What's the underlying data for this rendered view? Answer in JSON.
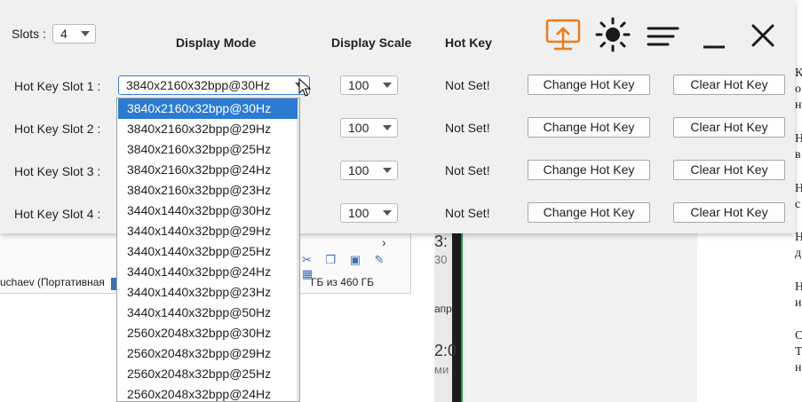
{
  "background": {
    "explorer": {
      "path_text": "uchaev (Портативная",
      "disk_text": "ГБ из 460 ГБ",
      "chevron": "›"
    },
    "middle": {
      "frag1": "3:",
      "frag2": "30",
      "frag3": "апр",
      "frag4": "2:0",
      "frag5": "ми"
    },
    "right_edge_chars": [
      "К",
      "о",
      "н",
      "Н",
      "в",
      "Н",
      "с",
      "Н",
      "д",
      "Н",
      "и",
      "С",
      "Т",
      "н"
    ]
  },
  "app": {
    "slots_label": "Slots :",
    "slots_value": "4",
    "columns": {
      "display_mode": "Display Mode",
      "display_scale": "Display Scale",
      "hot_key": "Hot Key"
    },
    "rows": [
      {
        "label": "Hot Key Slot 1 :",
        "mode": "3840x2160x32bpp@30Hz",
        "scale": "100",
        "hotkey": "Not Set!",
        "change": "Change Hot Key",
        "clear": "Clear Hot Key"
      },
      {
        "label": "Hot Key Slot 2 :",
        "mode": "",
        "scale": "100",
        "hotkey": "Not Set!",
        "change": "Change Hot Key",
        "clear": "Clear Hot Key"
      },
      {
        "label": "Hot Key Slot 3 :",
        "mode": "",
        "scale": "100",
        "hotkey": "Not Set!",
        "change": "Change Hot Key",
        "clear": "Clear Hot Key"
      },
      {
        "label": "Hot Key Slot 4 :",
        "mode": "",
        "scale": "100",
        "hotkey": "Not Set!",
        "change": "Change Hot Key",
        "clear": "Clear Hot Key"
      }
    ],
    "toolbar_icons": [
      "cast-upload-icon",
      "brightness-icon",
      "menu-icon",
      "minimize-icon",
      "close-icon"
    ],
    "accent_color": "#f07a1a"
  },
  "dropdown": {
    "selected_index": 0,
    "options": [
      "3840x2160x32bpp@30Hz",
      "3840x2160x32bpp@29Hz",
      "3840x2160x32bpp@25Hz",
      "3840x2160x32bpp@24Hz",
      "3840x2160x32bpp@23Hz",
      "3440x1440x32bpp@30Hz",
      "3440x1440x32bpp@29Hz",
      "3440x1440x32bpp@25Hz",
      "3440x1440x32bpp@24Hz",
      "3440x1440x32bpp@23Hz",
      "3440x1440x32bpp@50Hz",
      "2560x2048x32bpp@30Hz",
      "2560x2048x32bpp@29Hz",
      "2560x2048x32bpp@25Hz",
      "2560x2048x32bpp@24Hz"
    ]
  }
}
